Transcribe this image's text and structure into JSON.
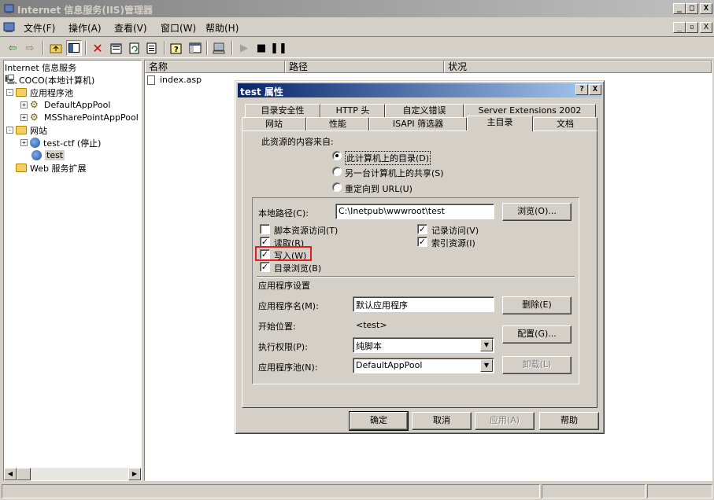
{
  "window": {
    "title": "Internet 信息服务(IIS)管理器",
    "controls": {
      "minimize": "_",
      "maximize": "□",
      "close": "X"
    },
    "mdi_controls": {
      "minimize": "_",
      "restore": "▫",
      "close": "X"
    }
  },
  "menu": {
    "items": [
      "文件(F)",
      "操作(A)",
      "查看(V)",
      "窗口(W)",
      "帮助(H)"
    ]
  },
  "toolbar": {
    "icons": [
      "back-arrow-icon",
      "forward-arrow-icon",
      "up-folder-icon",
      "show-tree-icon",
      "delete-icon",
      "properties-icon",
      "refresh-icon",
      "export-icon",
      "help-icon",
      "console-icon",
      "computer-icon",
      "play-icon",
      "stop-icon",
      "pause-icon"
    ]
  },
  "tree": {
    "root": "Internet 信息服务",
    "items": [
      {
        "label": "COCO(本地计算机)"
      },
      {
        "label": "应用程序池",
        "expander": "-"
      },
      {
        "label": "DefaultAppPool",
        "expander": "+"
      },
      {
        "label": "MSSharePointAppPool",
        "expander": "+"
      },
      {
        "label": "网站",
        "expander": "-"
      },
      {
        "label": "test-ctf (停止)",
        "expander": "+"
      },
      {
        "label": "test"
      },
      {
        "label": "Web 服务扩展"
      }
    ]
  },
  "list": {
    "columns": [
      "名称",
      "路径",
      "状况"
    ],
    "rows": [
      {
        "name": "index.asp"
      }
    ]
  },
  "dialog": {
    "title": "test 属性",
    "help_button": "?",
    "close_button": "X",
    "tabs_row1": [
      "目录安全性",
      "HTTP 头",
      "自定义错误",
      "Server Extensions 2002"
    ],
    "tabs_row2": [
      "网站",
      "性能",
      "ISAPI 筛选器",
      "主目录",
      "文档"
    ],
    "active_tab": "主目录",
    "source_label": "此资源的内容来自:",
    "radios": [
      {
        "label": "此计算机上的目录(D)",
        "checked": true
      },
      {
        "label": "另一台计算机上的共享(S)",
        "checked": false
      },
      {
        "label": "重定向到 URL(U)",
        "checked": false
      }
    ],
    "local_path_label": "本地路径(C):",
    "local_path_value": "C:\\Inetpub\\wwwroot\\test",
    "browse_button": "浏览(O)...",
    "checkboxes_left": [
      {
        "label": "脚本资源访问(T)",
        "checked": false
      },
      {
        "label": "读取(R)",
        "checked": true
      },
      {
        "label": "写入(W)",
        "checked": true
      },
      {
        "label": "目录浏览(B)",
        "checked": true
      }
    ],
    "checkboxes_right": [
      {
        "label": "记录访问(V)",
        "checked": true
      },
      {
        "label": "索引资源(I)",
        "checked": true
      }
    ],
    "check_mark": "✓",
    "app_settings_label": "应用程序设置",
    "app_name_label": "应用程序名(M):",
    "app_name_value": "默认应用程序",
    "remove_button": "删除(E)",
    "start_point_label": "开始位置:",
    "start_point_value": "<test>",
    "configure_button": "配置(G)...",
    "exec_perm_label": "执行权限(P):",
    "exec_perm_value": "纯脚本",
    "app_pool_label": "应用程序池(N):",
    "app_pool_value": "DefaultAppPool",
    "unload_button": "卸载(L)",
    "footer_buttons": [
      "确定",
      "取消",
      "应用(A)",
      "帮助"
    ]
  },
  "colors": {
    "dialog_title_start": "#0a246a",
    "dialog_title_end": "#a6caf0",
    "highlight_box": "#e02020"
  }
}
